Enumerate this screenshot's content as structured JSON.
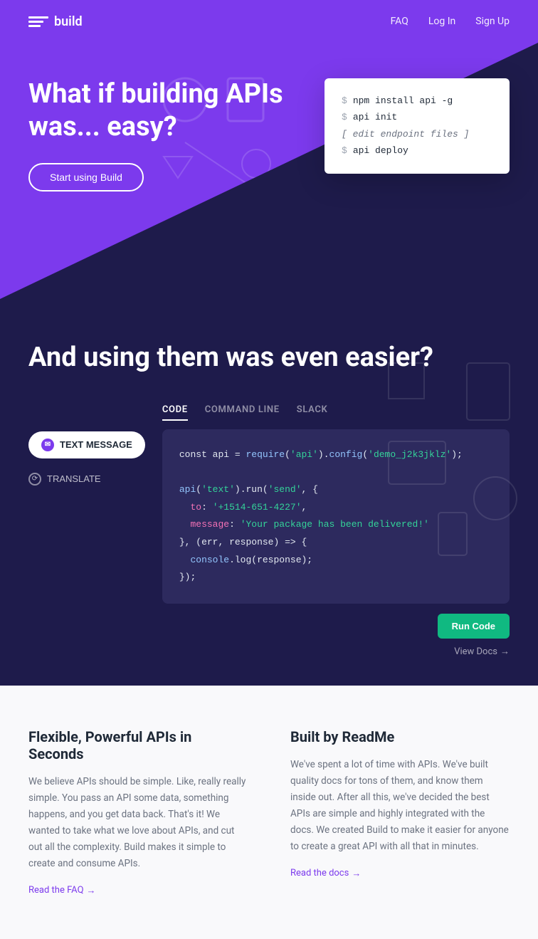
{
  "nav": {
    "logo_text": "build",
    "links": [
      {
        "label": "FAQ",
        "id": "faq"
      },
      {
        "label": "Log In",
        "id": "login"
      },
      {
        "label": "Sign Up",
        "id": "signup"
      }
    ]
  },
  "hero": {
    "title": "What if building APIs was... easy?",
    "cta_label": "Start using Build",
    "code_lines": [
      {
        "type": "cmd",
        "text": "npm install api -g"
      },
      {
        "type": "cmd",
        "text": "api init"
      },
      {
        "type": "bracket",
        "text": "[ edit endpoint files ]"
      },
      {
        "type": "cmd",
        "text": "api deploy"
      }
    ]
  },
  "middle": {
    "title": "And using them was even easier?",
    "sidebar_buttons": [
      {
        "label": "TEXT MESSAGE",
        "active": true
      },
      {
        "label": "TRANSLATE",
        "active": false
      }
    ],
    "tabs": [
      {
        "label": "CODE",
        "active": true
      },
      {
        "label": "COMMAND LINE",
        "active": false
      },
      {
        "label": "SLACK",
        "active": false
      }
    ],
    "code_content": "const api = require('api').config('demo_j2k3jklz');\n\napi('text').run('send', {\n  to: '+1514-651-4227',\n  message: 'Your package has been delivered!'\n}, (err, response) => {\n  console.log(response);\n});",
    "run_btn_label": "Run Code",
    "view_docs_label": "View Docs"
  },
  "bottom": {
    "col1": {
      "title": "Flexible, Powerful APIs in Seconds",
      "text": "We believe APIs should be simple. Like, really really simple. You pass an API some data, something happens, and you get data back. That's it! We wanted to take what we love about APIs, and cut out all the complexity. Build makes it simple to create and consume APIs.",
      "link_label": "Read the FAQ"
    },
    "col2": {
      "title": "Built by ReadMe",
      "text": "We've spent a lot of time with APIs. We've built quality docs for tons of them, and know them inside out. After all this, we've decided the best APIs are simple and highly integrated with the docs. We created Build to make it easier for anyone to create a great API with all that in minutes.",
      "link_label": "Read the docs"
    }
  },
  "colors": {
    "purple": "#7c3aed",
    "dark_navy": "#1e1b4b",
    "green": "#10b981",
    "code_bg": "#2d2a5e"
  }
}
